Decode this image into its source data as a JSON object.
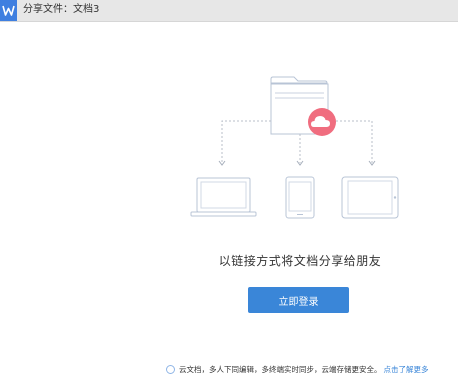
{
  "window": {
    "title": "分享文件：文档3",
    "app_icon": "wps-logo-icon",
    "accent_color": "#3f7fe0"
  },
  "main": {
    "tagline": "以链接方式将文档分享给朋友",
    "login_button": "立即登录",
    "button_color": "#3a86d8",
    "cloud_badge_color": "#f06d7f",
    "device_icons": [
      "laptop-icon",
      "phone-icon",
      "tablet-icon"
    ]
  },
  "footer": {
    "icon": "cloud-doc-icon",
    "text": "云文档，多人下同编辑，多终端实时同步，云端存储更安全。",
    "link": "点击了解更多"
  }
}
